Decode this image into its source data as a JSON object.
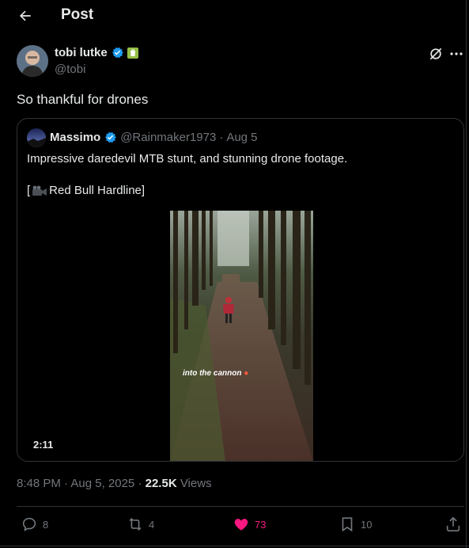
{
  "header": {
    "title": "Post",
    "back_icon": "arrow-left-icon"
  },
  "post": {
    "author_name": "tobi lutke",
    "author_handle": "@tobi",
    "text": "So thankful for drones",
    "timestamp": "8:48 PM · Aug 5, 2025",
    "views_count": "22.5K",
    "views_label": "Views"
  },
  "quote": {
    "author_name": "Massimo",
    "author_handle": "@Rainmaker1973",
    "separator": "·",
    "date": "Aug 5",
    "text_line1": "Impressive daredevil MTB stunt, and stunning drone footage.",
    "text_line2_prefix": "[",
    "text_line2_rest": " Red Bull Hardline]",
    "video_overlay": "into the cannon",
    "video_duration": "2:11"
  },
  "actions": {
    "replies": "8",
    "reposts": "4",
    "likes": "73",
    "bookmarks": "10"
  },
  "colors": {
    "background": "#000000",
    "text": "#e7e9ea",
    "muted": "#71767b",
    "border": "#2f3336",
    "verified": "#1d9bf0",
    "like": "#f91880"
  }
}
